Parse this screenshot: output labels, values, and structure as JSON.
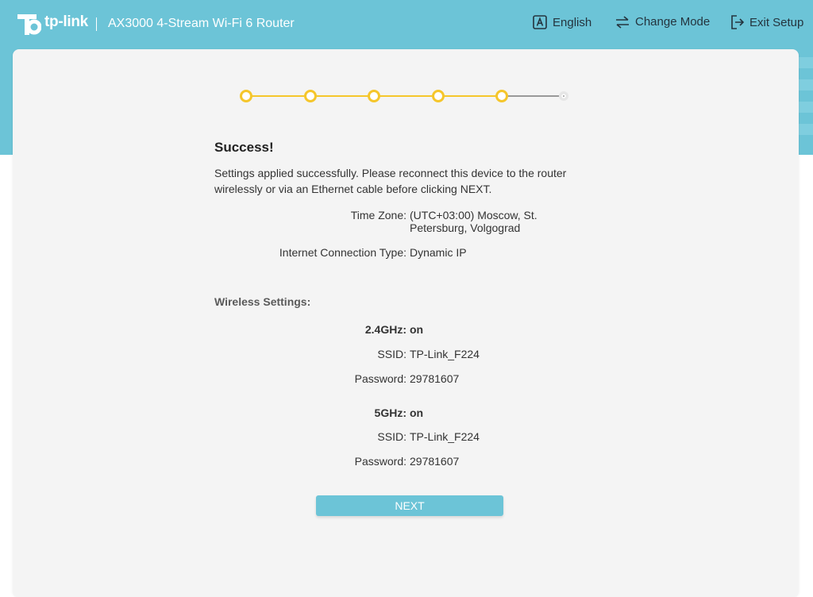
{
  "header": {
    "logo_text": "tp-link",
    "product_title": "AX3000 4-Stream Wi-Fi 6 Router",
    "language_label": "English",
    "change_mode_label": "Change Mode",
    "exit_setup_label": "Exit Setup"
  },
  "stepper": {
    "total_steps": 6,
    "completed_steps": 5
  },
  "colors": {
    "brand": "#6cc4d7",
    "step_active": "#f5c62b",
    "step_inactive": "#999999"
  },
  "result": {
    "title": "Success!",
    "message": "Settings applied successfully. Please reconnect this device to the router wirelessly or via an Ethernet cable before clicking NEXT."
  },
  "summary": {
    "time_zone_label": "Time Zone:",
    "time_zone_value": "(UTC+03:00) Moscow, St. Petersburg, Volgograd",
    "connection_type_label": "Internet Connection Type:",
    "connection_type_value": "Dynamic IP"
  },
  "wireless": {
    "section_label": "Wireless Settings:",
    "band_24": {
      "label": "2.4GHz:",
      "status": "on",
      "ssid_label": "SSID:",
      "ssid": "TP-Link_F224",
      "password_label": "Password:",
      "password": "29781607"
    },
    "band_5": {
      "label": "5GHz:",
      "status": "on",
      "ssid_label": "SSID:",
      "ssid": "TP-Link_F224",
      "password_label": "Password:",
      "password": "29781607"
    }
  },
  "actions": {
    "next_label": "NEXT"
  },
  "icons": {
    "logo": "tp-link-logo-icon",
    "language": "language-icon",
    "change_mode": "change-mode-icon",
    "exit": "exit-icon"
  }
}
